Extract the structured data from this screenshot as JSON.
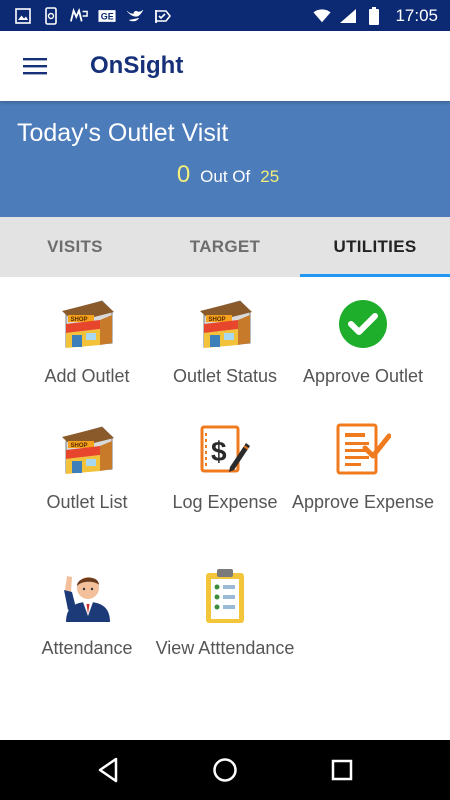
{
  "status_bar": {
    "time": "17:05",
    "left_icons": [
      "image-icon",
      "phone-sync-icon",
      "mp-icon",
      "ge-icon",
      "bird-icon",
      "check-flag-icon"
    ],
    "right_icons": [
      "wifi-icon",
      "signal-icon",
      "battery-icon"
    ]
  },
  "app_bar": {
    "title": "OnSight",
    "menu_icon": "hamburger-menu-icon"
  },
  "banner": {
    "title": "Today's Outlet Visit",
    "visited": "0",
    "separator": "Out Of",
    "total": "25"
  },
  "tabs": [
    {
      "label": "VISITS",
      "active": false
    },
    {
      "label": "TARGET",
      "active": false
    },
    {
      "label": "UTILITIES",
      "active": true
    }
  ],
  "utilities": [
    {
      "label": "Add Outlet",
      "icon": "shop-icon"
    },
    {
      "label": "Outlet Status",
      "icon": "shop-icon"
    },
    {
      "label": "Approve Outlet",
      "icon": "green-check-icon"
    },
    {
      "label": "Outlet List",
      "icon": "shop-icon"
    },
    {
      "label": "Log Expense",
      "icon": "expense-icon"
    },
    {
      "label": "Approve Expense",
      "icon": "approve-document-icon"
    },
    {
      "label": "Attendance",
      "icon": "person-waving-icon"
    },
    {
      "label": "View Atttendance",
      "icon": "clipboard-checklist-icon"
    }
  ],
  "nav_bar": {
    "icons": [
      "back-icon",
      "home-icon",
      "recents-icon"
    ]
  },
  "colors": {
    "status_bar": "#0b2a73",
    "title": "#16307a",
    "banner": "#4c7cba",
    "count_highlight": "#f3f07a",
    "tab_indicator": "#2196f3",
    "check_green": "#1fae2c",
    "expense_orange": "#f07a1e"
  }
}
